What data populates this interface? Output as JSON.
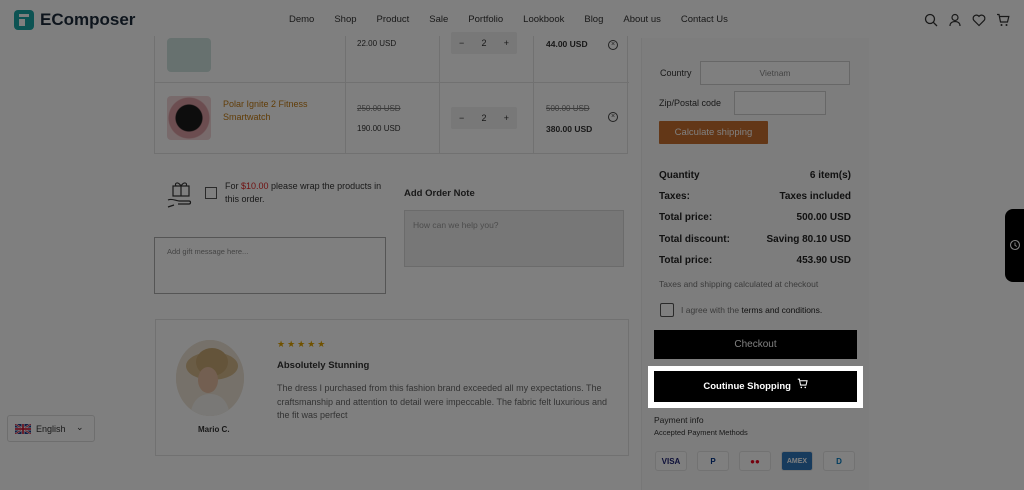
{
  "header": {
    "logo_text": "EComposer",
    "nav": [
      "Demo",
      "Shop",
      "Product",
      "Sale",
      "Portfolio",
      "Lookbook",
      "Blog",
      "About us",
      "Contact Us"
    ]
  },
  "cart": {
    "row1": {
      "price": "22.00 USD",
      "qty": "2",
      "total": "44.00 USD"
    },
    "row2": {
      "name": "Polar Ignite 2 Fitness Smartwatch",
      "price_old": "250.00 USD",
      "price_new": "190.00 USD",
      "qty": "2",
      "total_old": "500.00 USD",
      "total_new": "380.00 USD"
    },
    "qty_minus": "−",
    "qty_plus": "+",
    "remove": "×"
  },
  "gift": {
    "text_before": "For ",
    "amount": "$10.00",
    "text_after": " please wrap the products in this order.",
    "message_placeholder": "Add gift message here..."
  },
  "order_note": {
    "title": "Add Order Note",
    "placeholder": "How can we help you?"
  },
  "review": {
    "stars": "★★★★★",
    "title": "Absolutely Stunning",
    "body": "The dress I purchased from this fashion brand exceeded all my expectations. The craftsmanship and attention to detail were impeccable. The fabric felt luxurious and the fit was perfect",
    "reviewer": "Mario C."
  },
  "shipping": {
    "country_label": "Country",
    "country_value": "Vietnam",
    "zip_label": "Zip/Postal code",
    "zip_value": "",
    "calculate_label": "Calculate shipping"
  },
  "summary": {
    "rows": [
      {
        "k": "Quantity",
        "v": "6 item(s)"
      },
      {
        "k": "Taxes:",
        "v": "Taxes included"
      },
      {
        "k": "Total price:",
        "v": "500.00 USD"
      },
      {
        "k": "Total discount:",
        "v": "Saving 80.10 USD"
      },
      {
        "k": "Total price:",
        "v": "453.90 USD"
      }
    ],
    "tax_note": "Taxes and shipping calculated at checkout",
    "agree_prefix": "I agree with the ",
    "agree_link": "terms and conditions.",
    "checkout_label": "Checkout",
    "continue_label": "Coutinue Shopping",
    "payment_info": "Payment info",
    "payment_sub": "Accepted Payment Methods",
    "payment_methods": [
      "VISA",
      "P",
      "●●",
      "AMEX",
      "D"
    ]
  },
  "language": {
    "label": "English"
  },
  "colors": {
    "accent": "#c76f2e",
    "link": "#c37a10",
    "discount": "#d22222"
  }
}
